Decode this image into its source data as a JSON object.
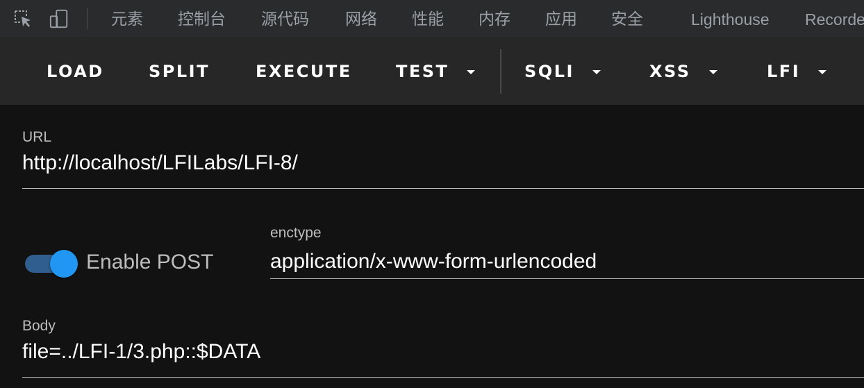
{
  "devtools": {
    "tabs": [
      "元素",
      "控制台",
      "源代码",
      "网络",
      "性能",
      "内存",
      "应用",
      "安全",
      "Lighthouse",
      "Recorde"
    ],
    "icons": [
      "inspect-element-icon",
      "device-toolbar-icon"
    ]
  },
  "toolbar": {
    "load": "LOAD",
    "split": "SPLIT",
    "execute": "EXECUTE",
    "test": "TEST",
    "sqli": "SQLI",
    "xss": "XSS",
    "lfi": "LFI"
  },
  "url": {
    "label": "URL",
    "value": "http://localhost/LFILabs/LFI-8/"
  },
  "post": {
    "toggle_label": "Enable POST",
    "enabled": true
  },
  "enctype": {
    "label": "enctype",
    "value": "application/x-www-form-urlencoded"
  },
  "body": {
    "label": "Body",
    "value": "file=../LFI-1/3.php::$DATA"
  },
  "colors": {
    "accent": "#2196f3",
    "toolbar_bg": "#272727",
    "page_bg": "#121212"
  }
}
